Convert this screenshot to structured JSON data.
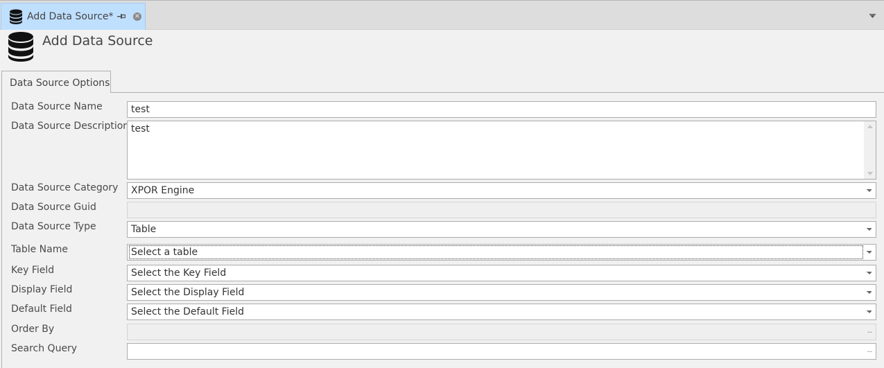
{
  "document_tab": {
    "label": "Add Data Source*",
    "icon": "database-icon",
    "pin_icon": "pin-icon",
    "close_icon": "close-icon"
  },
  "tabbar_menu_icon": "chevron-down-icon",
  "header": {
    "title": "Add Data Source",
    "icon": "database-icon"
  },
  "tabs": [
    {
      "label": "Data Source Options",
      "active": true
    }
  ],
  "form": {
    "fields": [
      {
        "label": "Data Source Name",
        "type": "text",
        "value": "test"
      },
      {
        "label": "Data Source Description",
        "type": "memo",
        "value": "test"
      },
      {
        "label": "Data Source Category",
        "type": "dropdown",
        "value": "XPOR Engine"
      },
      {
        "label": "Data Source Guid",
        "type": "text",
        "value": "",
        "disabled": true
      },
      {
        "label": "Data Source Type",
        "type": "dropdown",
        "value": "Table"
      },
      {
        "label": "Table Name",
        "type": "dropdown",
        "value": "",
        "placeholder": "Select a table",
        "focused": true
      },
      {
        "label": "Key Field",
        "type": "dropdown",
        "value": "",
        "placeholder": "Select the Key Field"
      },
      {
        "label": "Display Field",
        "type": "dropdown",
        "value": "",
        "placeholder": "Select the Display Field"
      },
      {
        "label": "Default Field",
        "type": "dropdown",
        "value": "",
        "placeholder": "Select the Default Field"
      },
      {
        "label": "Order By",
        "type": "button-edit",
        "value": "",
        "disabled": true,
        "button": "..."
      },
      {
        "label": "Search Query",
        "type": "button-edit",
        "value": "",
        "button": "..."
      }
    ]
  }
}
